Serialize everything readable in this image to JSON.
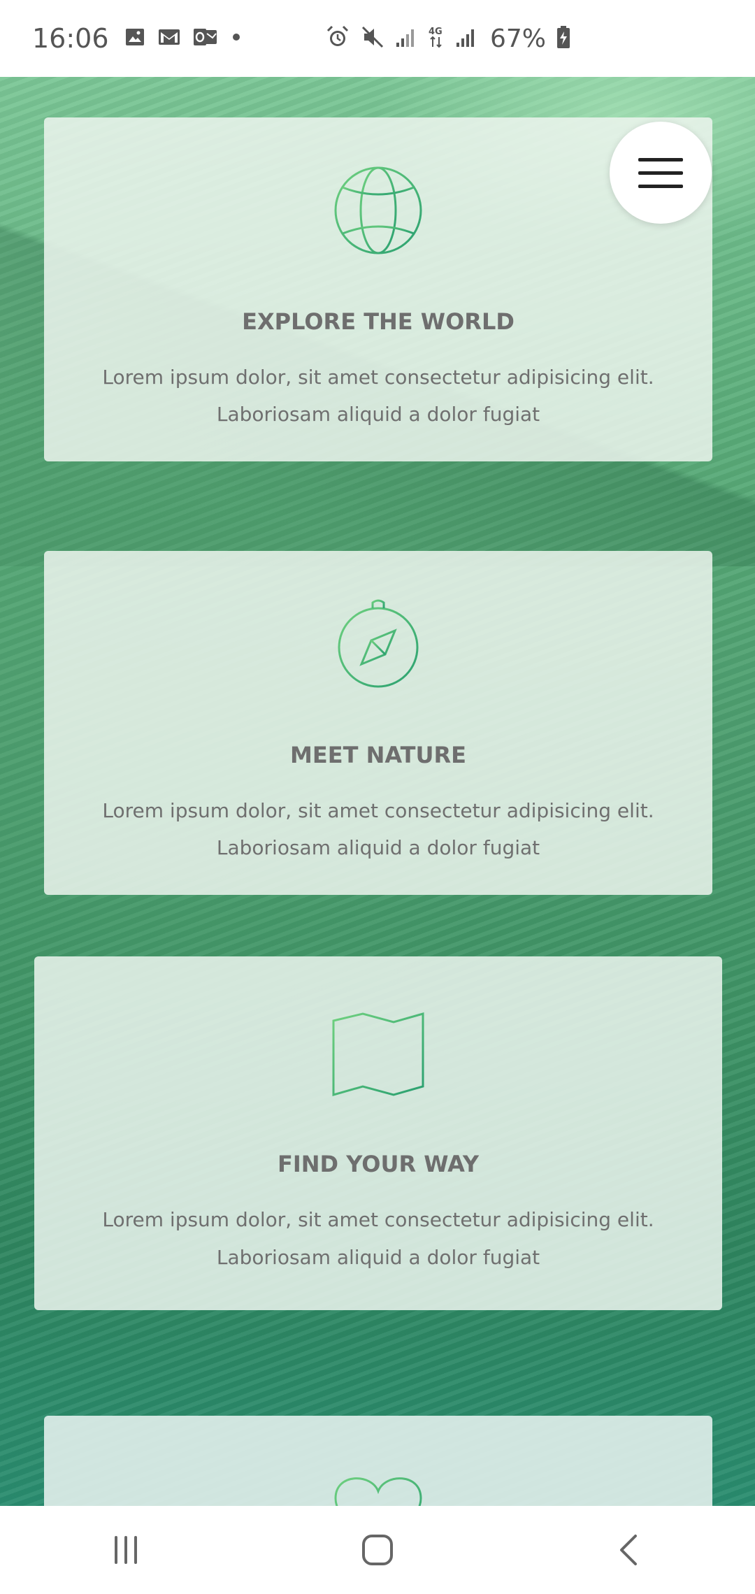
{
  "status_bar": {
    "time": "16:06",
    "battery": "67%",
    "icons": [
      "gallery-icon",
      "gmail-icon",
      "outlook-icon",
      "dot-icon",
      "alarm-icon",
      "mute-icon",
      "signal-icon",
      "4g-icon",
      "signal-icon",
      "battery-charging-icon"
    ]
  },
  "cards": [
    {
      "title": "EXPLORE THE WORLD",
      "text_line1": "Lorem ipsum dolor, sit amet consectetur adipisicing elit.",
      "text_line2": "Laboriosam aliquid a dolor fugiat",
      "icon": "globe-icon"
    },
    {
      "title": "MEET NATURE",
      "text_line1": "Lorem ipsum dolor, sit amet consectetur adipisicing elit.",
      "text_line2": "Laboriosam aliquid a dolor fugiat",
      "icon": "compass-icon"
    },
    {
      "title": "FIND YOUR WAY",
      "text_line1": "Lorem ipsum dolor, sit amet consectetur adipisicing elit.",
      "text_line2": "Laboriosam aliquid a dolor fugiat",
      "icon": "map-icon"
    },
    {
      "icon": "heart-icon"
    }
  ],
  "menu_button": {
    "icon": "hamburger-icon"
  },
  "nav_bar": {
    "buttons": [
      "recent-apps-icon",
      "home-icon",
      "back-icon"
    ]
  },
  "colors": {
    "accent_green": "#3fba6e",
    "icon_green_light": "#5cc878",
    "icon_green_dark": "#2aa070"
  }
}
